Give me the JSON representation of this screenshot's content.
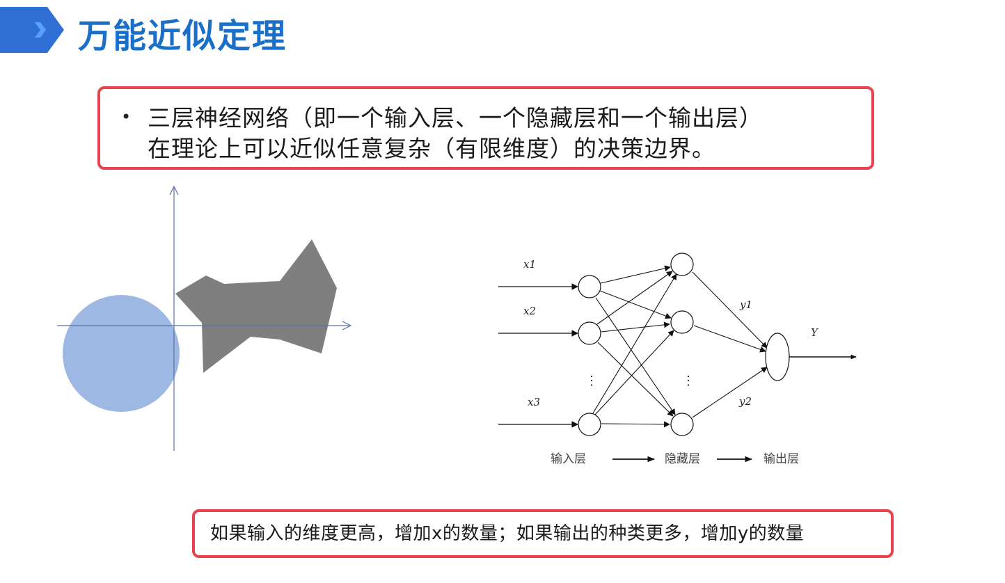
{
  "slide": {
    "title": "万能近似定理",
    "accent_color": "#1a6fc9",
    "chevron_color": "#2f6fd6"
  },
  "statement": {
    "bullet": "•",
    "line1": "三层神经网络（即一个输入层、一个隐藏层和一个输出层）",
    "line2": "在理论上可以近似任意复杂（有限维度）的决策边界。",
    "border_color": "#e8424e"
  },
  "boundary_plot": {
    "circle_color": "#9db8e2",
    "polygon_color": "#7f7f7f",
    "axis_color": "#5b6ea8"
  },
  "network": {
    "inputs": [
      "x1",
      "x2",
      "x3"
    ],
    "hidden_outputs": [
      "y1",
      "y2"
    ],
    "output": "Y",
    "ellipsis": "⋮",
    "layer_labels": [
      "输入层",
      "隐藏层",
      "输出层"
    ]
  },
  "note": {
    "text": "如果输入的维度更高，增加x的数量；如果输出的种类更多，增加y的数量",
    "border_color": "#e8424e"
  }
}
